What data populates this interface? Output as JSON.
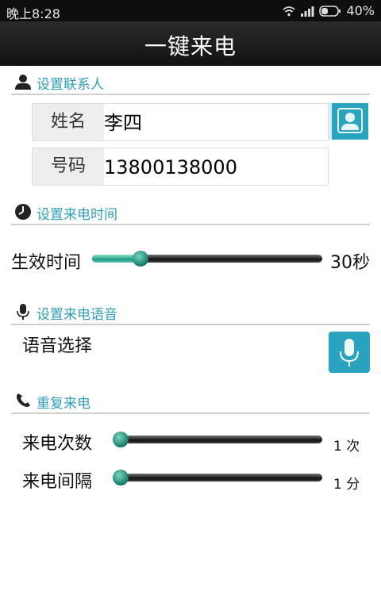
{
  "status_bar": {
    "time": "晚上8:28",
    "battery": "40%"
  },
  "header": {
    "title": "一键来电"
  },
  "contact": {
    "section_title": "设置联系人",
    "name_label": "姓名",
    "name_value": "李四",
    "phone_label": "号码",
    "phone_value": "13800138000"
  },
  "time": {
    "section_title": "设置来电时间",
    "label": "生效时间",
    "value": "30秒",
    "level": 0.19
  },
  "voice": {
    "section_title": "设置来电语音",
    "label": "语音选择"
  },
  "repeat": {
    "section_title": "重复来电",
    "count_label": "来电次数",
    "count_value": "1 次",
    "count_level": 0.0,
    "interval_label": "来电间隔",
    "interval_value": "1 分",
    "interval_level": 0.0
  },
  "colors": {
    "accent": "#2aa3bf",
    "slider_fill": "#1f9c86",
    "header_bg": "#1a1a1a"
  },
  "icons": [
    "wifi-icon",
    "signal-icon",
    "battery-icon",
    "person-icon",
    "contact-card-icon",
    "clock-icon",
    "microphone-icon",
    "phone-icon"
  ]
}
